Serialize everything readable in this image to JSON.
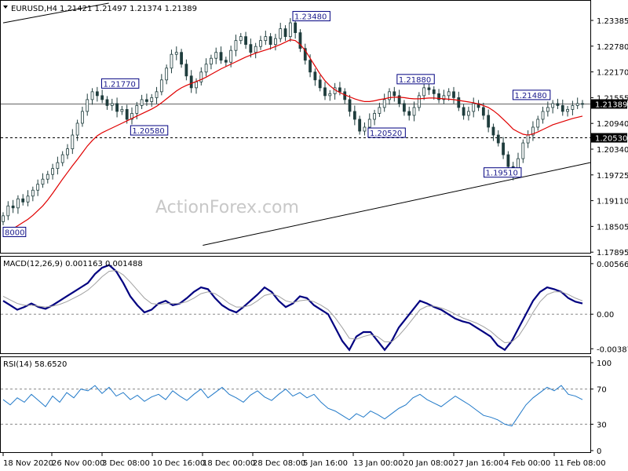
{
  "header": {
    "symbol": "EURUSD,H4",
    "ohlc": "1.21421 1.21497 1.21374 1.21389"
  },
  "watermark": "ActionForex.com",
  "colors": {
    "candle": "#1f3d3d",
    "ma": "#e00000",
    "macd": "#000080",
    "signal": "#a0a0a0",
    "rsi": "#1f78c8",
    "label_border": "#000080",
    "current_price_bg": "#000000"
  },
  "chart_data": [
    {
      "type": "candlestick",
      "title": "EURUSD,H4",
      "ylim": [
        1.1765,
        1.2395
      ],
      "y_ticks": [
        "1.23385",
        "1.22780",
        "1.22170",
        "1.21555",
        "1.20940",
        "1.20340",
        "1.19725",
        "1.19110",
        "1.18505",
        "1.17895"
      ],
      "x_ticks": [
        "18 Nov 2020",
        "26 Nov 00:00",
        "3 Dec 08:00",
        "10 Dec 16:00",
        "18 Dec 00:00",
        "28 Dec 08:00",
        "5 Jan 16:00",
        "13 Jan 00:00",
        "20 Jan 08:00",
        "27 Jan 16:00",
        "4 Feb 00:00",
        "11 Feb 08:00"
      ],
      "close_series": [
        1.1855,
        1.188,
        1.1875,
        1.1898,
        1.189,
        1.1905,
        1.192,
        1.1935,
        1.1948,
        1.196,
        1.1975,
        1.199,
        1.201,
        1.2025,
        1.206,
        1.209,
        1.212,
        1.215,
        1.217,
        1.216,
        1.215,
        1.2135,
        1.214,
        1.212,
        1.2125,
        1.21,
        1.2115,
        1.2135,
        1.215,
        1.2145,
        1.2155,
        1.217,
        1.22,
        1.223,
        1.2265,
        1.227,
        1.224,
        1.221,
        1.218,
        1.2195,
        1.222,
        1.224,
        1.2255,
        1.227,
        1.225,
        1.2245,
        1.2275,
        1.23,
        1.231,
        1.229,
        1.227,
        1.2285,
        1.23,
        1.231,
        1.229,
        1.2305,
        1.233,
        1.231,
        1.2345,
        1.232,
        1.228,
        1.225,
        1.222,
        1.22,
        1.218,
        1.216,
        1.2165,
        1.218,
        1.217,
        1.215,
        1.212,
        1.21,
        1.207,
        1.208,
        1.21,
        1.2115,
        1.213,
        1.215,
        1.217,
        1.216,
        1.214,
        1.212,
        1.211,
        1.213,
        1.216,
        1.218,
        1.2175,
        1.2165,
        1.215,
        1.216,
        1.217,
        1.2155,
        1.213,
        1.211,
        1.212,
        1.214,
        1.213,
        1.211,
        1.208,
        1.206,
        1.204,
        1.201,
        1.198,
        1.196,
        1.2,
        1.204,
        1.206,
        1.208,
        1.21,
        1.212,
        1.213,
        1.214,
        1.2135,
        1.212,
        1.2125,
        1.2135,
        1.214,
        1.2139
      ],
      "ma_series": [
        1.181,
        1.1815,
        1.1822,
        1.183,
        1.1838,
        1.1846,
        1.1856,
        1.1868,
        1.188,
        1.1895,
        1.1912,
        1.193,
        1.1948,
        1.1965,
        1.1982,
        1.1998,
        1.2015,
        1.2032,
        1.2046,
        1.2058,
        1.2066,
        1.2072,
        1.2078,
        1.2084,
        1.209,
        1.2096,
        1.2102,
        1.2108,
        1.2114,
        1.212,
        1.2126,
        1.2133,
        1.2142,
        1.2152,
        1.2162,
        1.2172,
        1.218,
        1.2186,
        1.2191,
        1.2196,
        1.2201,
        1.2207,
        1.2214,
        1.2221,
        1.2228,
        1.2234,
        1.224,
        1.2246,
        1.2252,
        1.2258,
        1.2263,
        1.2268,
        1.2272,
        1.2276,
        1.228,
        1.2285,
        1.229,
        1.2296,
        1.2302,
        1.23,
        1.229,
        1.2275,
        1.2255,
        1.2235,
        1.2215,
        1.2198,
        1.2185,
        1.2175,
        1.2168,
        1.2162,
        1.2157,
        1.2152,
        1.2148,
        1.2145,
        1.2145,
        1.2147,
        1.215,
        1.2152,
        1.2155,
        1.2156,
        1.2156,
        1.2155,
        1.2153,
        1.2152,
        1.2152,
        1.2153,
        1.2154,
        1.2154,
        1.2153,
        1.2152,
        1.2151,
        1.215,
        1.2148,
        1.2146,
        1.2144,
        1.2142,
        1.2139,
        1.2135,
        1.213,
        1.2122,
        1.2112,
        1.21,
        1.2088,
        1.2075,
        1.2068,
        1.2062,
        1.206,
        1.2063,
        1.2068,
        1.2074,
        1.208,
        1.2086,
        1.209,
        1.2094,
        1.2098,
        1.2102,
        1.2105,
        1.2108
      ],
      "price_labels": [
        {
          "text": "1.23480",
          "value": 1.2348,
          "at": 0.5
        },
        {
          "text": "1.21770",
          "value": 1.2177,
          "at": 0.17
        },
        {
          "text": "1.21880",
          "value": 1.2188,
          "at": 0.68
        },
        {
          "text": "1.21480",
          "value": 1.2148,
          "at": 0.88
        },
        {
          "text": "1.20580",
          "value": 1.2058,
          "at": 0.22
        },
        {
          "text": "1.20520",
          "value": 1.2052,
          "at": 0.63
        },
        {
          "text": "1.19510",
          "value": 1.1951,
          "at": 0.83
        },
        {
          "text": "8000",
          "value": 1.18,
          "at": 0.0
        }
      ],
      "horizontal_levels": [
        {
          "value": 1.21389,
          "text": "1.21389",
          "style": "solid"
        },
        {
          "value": 1.2053,
          "text": "1.20530",
          "style": "dashed"
        }
      ],
      "trendlines": [
        {
          "from": [
            0.0,
            1.2345
          ],
          "to": [
            0.18,
            1.2395
          ]
        },
        {
          "from": [
            0.34,
            1.178
          ],
          "to": [
            1.0,
            1.199
          ]
        }
      ]
    },
    {
      "type": "line",
      "title": "MACD(12,26,9) 0.001163 0.001488",
      "ylim": [
        -0.0042,
        0.006
      ],
      "y_ticks": [
        "0.005662",
        "0.00",
        "-0.003872"
      ],
      "zero_line": 0.0,
      "series": [
        {
          "name": "MACD",
          "values": [
            0.0015,
            0.001,
            0.0005,
            0.0008,
            0.0012,
            0.0008,
            0.0006,
            0.001,
            0.0015,
            0.002,
            0.0025,
            0.003,
            0.0035,
            0.0045,
            0.0052,
            0.0055,
            0.0048,
            0.0035,
            0.002,
            0.001,
            0.0002,
            0.0005,
            0.0012,
            0.0015,
            0.001,
            0.0012,
            0.0018,
            0.0025,
            0.003,
            0.0028,
            0.0018,
            0.001,
            0.0005,
            0.0002,
            0.0008,
            0.0015,
            0.0022,
            0.003,
            0.0025,
            0.0015,
            0.0008,
            0.0012,
            0.002,
            0.0018,
            0.001,
            0.0005,
            0.0,
            -0.0015,
            -0.003,
            -0.004,
            -0.0025,
            -0.002,
            -0.002,
            -0.003,
            -0.004,
            -0.003,
            -0.0015,
            -0.0005,
            0.0005,
            0.0015,
            0.0012,
            0.0008,
            0.0005,
            0.0,
            -0.0005,
            -0.0008,
            -0.001,
            -0.0015,
            -0.002,
            -0.0025,
            -0.0035,
            -0.004,
            -0.003,
            -0.0015,
            0.0,
            0.0015,
            0.0025,
            0.003,
            0.0028,
            0.0025,
            0.0018,
            0.0014,
            0.0012
          ]
        },
        {
          "name": "Signal",
          "values": [
            0.002,
            0.0016,
            0.0012,
            0.001,
            0.001,
            0.0009,
            0.0008,
            0.0009,
            0.0011,
            0.0014,
            0.0018,
            0.0022,
            0.0027,
            0.0034,
            0.0042,
            0.0048,
            0.0049,
            0.0044,
            0.0036,
            0.0027,
            0.0018,
            0.0012,
            0.0011,
            0.0012,
            0.0012,
            0.0012,
            0.0014,
            0.0018,
            0.0023,
            0.0025,
            0.0023,
            0.0018,
            0.0012,
            0.0008,
            0.0008,
            0.001,
            0.0015,
            0.0021,
            0.0023,
            0.002,
            0.0015,
            0.0013,
            0.0015,
            0.0016,
            0.0014,
            0.001,
            0.0005,
            -0.0004,
            -0.0015,
            -0.0027,
            -0.0028,
            -0.0025,
            -0.0023,
            -0.0025,
            -0.0031,
            -0.0031,
            -0.0024,
            -0.0015,
            -0.0005,
            0.0005,
            0.0009,
            0.0009,
            0.0007,
            0.0004,
            0.0,
            -0.0004,
            -0.0007,
            -0.001,
            -0.0014,
            -0.0019,
            -0.0026,
            -0.0032,
            -0.0031,
            -0.0024,
            -0.0012,
            0.0002,
            0.0014,
            0.0022,
            0.0025,
            0.0025,
            0.0022,
            0.0018,
            0.0015
          ]
        }
      ]
    },
    {
      "type": "line",
      "title": "RSI(14) 58.6520",
      "ylim": [
        0,
        100
      ],
      "y_ticks": [
        "100",
        "70",
        "30",
        "0"
      ],
      "levels": [
        70,
        30
      ],
      "series": [
        {
          "name": "RSI",
          "values": [
            58,
            52,
            60,
            55,
            64,
            57,
            50,
            62,
            55,
            66,
            60,
            70,
            68,
            74,
            65,
            72,
            62,
            66,
            58,
            63,
            56,
            61,
            64,
            58,
            68,
            62,
            57,
            64,
            70,
            60,
            66,
            72,
            64,
            60,
            55,
            63,
            68,
            61,
            57,
            64,
            70,
            62,
            66,
            60,
            64,
            55,
            48,
            45,
            40,
            35,
            42,
            38,
            45,
            41,
            36,
            42,
            48,
            52,
            60,
            64,
            58,
            54,
            50,
            56,
            62,
            57,
            52,
            46,
            40,
            38,
            35,
            30,
            28,
            40,
            52,
            60,
            66,
            72,
            68,
            74,
            64,
            62,
            58
          ]
        }
      ]
    }
  ]
}
